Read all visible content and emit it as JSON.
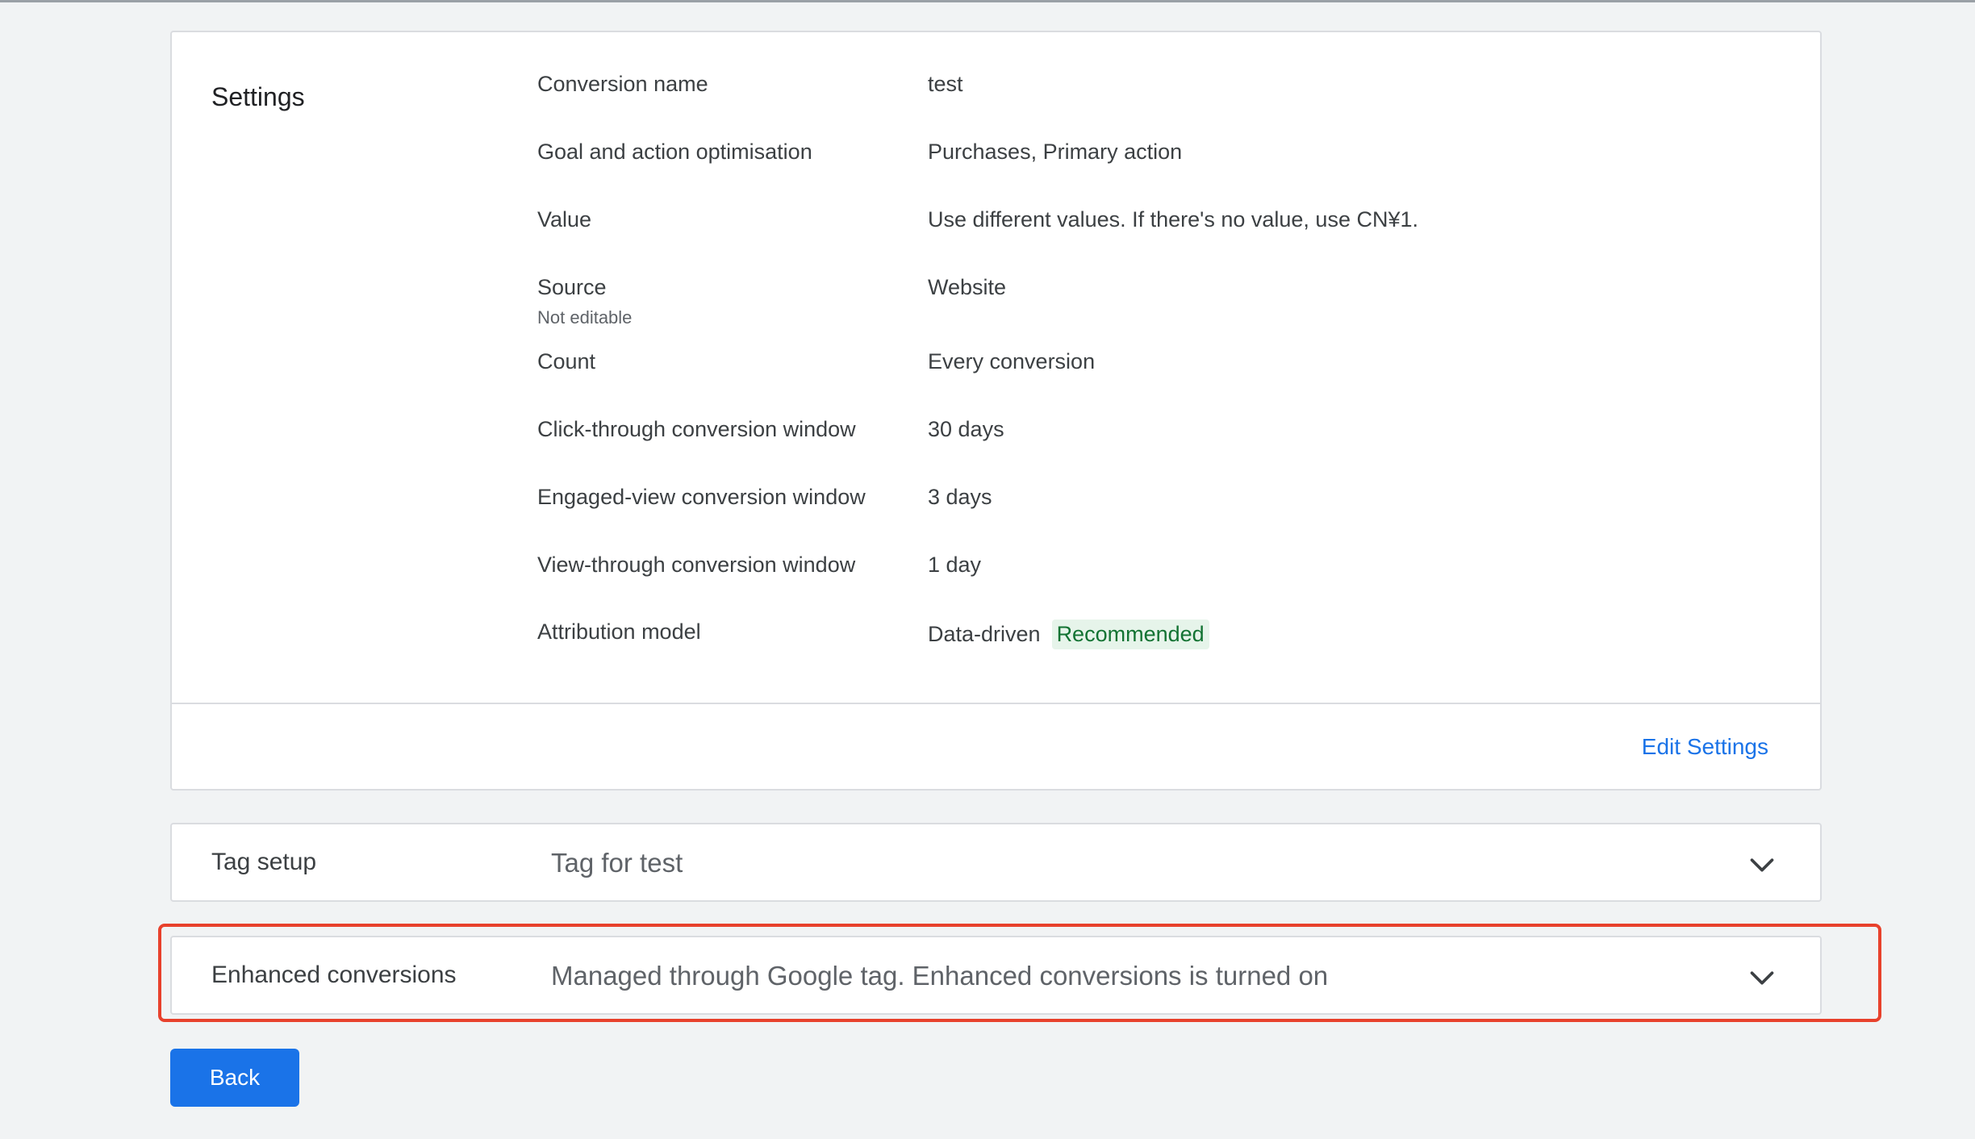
{
  "settings": {
    "title": "Settings",
    "rows": [
      {
        "label": "Conversion name",
        "value": "test"
      },
      {
        "label": "Goal and action optimisation",
        "value": "Purchases, Primary action"
      },
      {
        "label": "Value",
        "value": "Use different values. If there's no value, use CN¥1."
      },
      {
        "label": "Source",
        "sublabel": "Not editable",
        "value": "Website"
      },
      {
        "label": "Count",
        "value": "Every conversion"
      },
      {
        "label": "Click-through conversion window",
        "value": "30 days"
      },
      {
        "label": "Engaged-view conversion window",
        "value": "3 days"
      },
      {
        "label": "View-through conversion window",
        "value": "1 day"
      },
      {
        "label": "Attribution model",
        "value": "Data-driven",
        "badge": "Recommended"
      }
    ],
    "edit_label": "Edit Settings"
  },
  "tag_setup": {
    "label": "Tag setup",
    "summary": "Tag for test",
    "icon": "chevron-down-icon"
  },
  "enhanced_conversions": {
    "label": "Enhanced conversions",
    "summary": "Managed through Google tag. Enhanced conversions is turned on",
    "icon": "chevron-down-icon"
  },
  "back_button": {
    "label": "Back"
  },
  "colors": {
    "accent": "#1a73e8",
    "highlight_border": "#e8412c",
    "badge_bg": "#e6f4ea",
    "badge_text": "#137333"
  }
}
